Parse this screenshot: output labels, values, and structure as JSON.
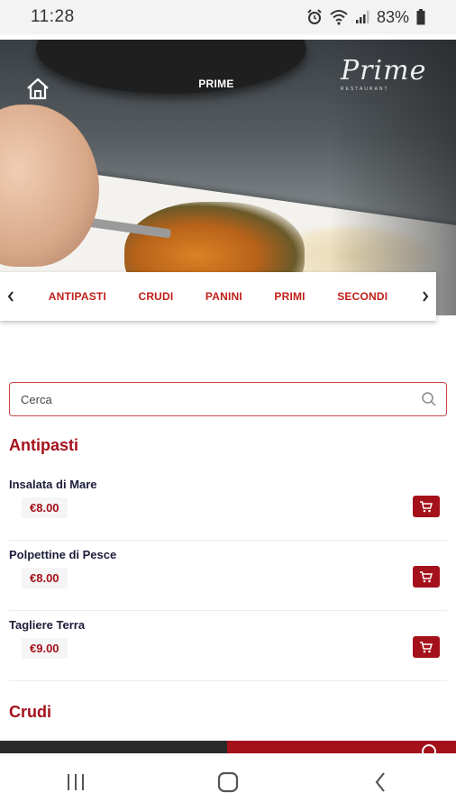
{
  "status_bar": {
    "time": "11:28",
    "battery": "83%",
    "icons": [
      "alarm-icon",
      "wifi-icon",
      "signal-icon",
      "battery-icon"
    ]
  },
  "header": {
    "title": "PRIME",
    "logo_text": "Prime",
    "logo_subtext": "RESTAURANT"
  },
  "categories": [
    {
      "label": "ANTIPASTI"
    },
    {
      "label": "CRUDI"
    },
    {
      "label": "PANINI"
    },
    {
      "label": "PRIMI"
    },
    {
      "label": "SECONDI"
    }
  ],
  "search": {
    "placeholder": "Cerca"
  },
  "sections": [
    {
      "title": "Antipasti",
      "items": [
        {
          "name": "Insalata di Mare",
          "price": "€8.00"
        },
        {
          "name": "Polpettine di Pesce",
          "price": "€8.00"
        },
        {
          "name": "Tagliere Terra",
          "price": "€9.00"
        }
      ]
    },
    {
      "title": "Crudi",
      "items": []
    }
  ],
  "colors": {
    "accent": "#a5111b",
    "category_text": "#c0201a"
  }
}
